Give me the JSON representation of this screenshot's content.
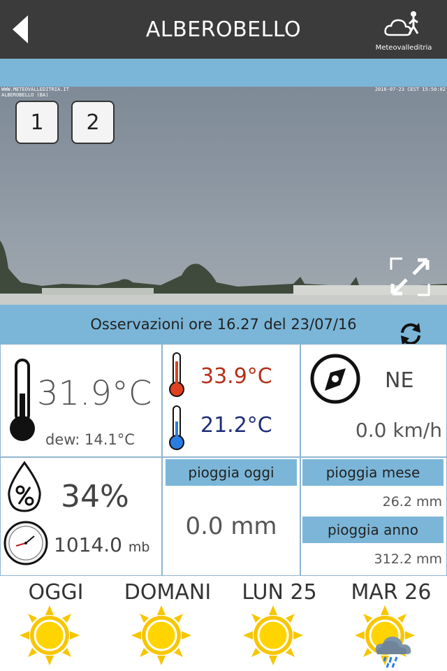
{
  "header": {
    "title": "ALBEROBELLO",
    "logo_text": "Meteovalleditria"
  },
  "webcam": {
    "overlay_left": "WWW.METEOVALLEDITRIA.IT\nALBEROBELLO (BA)",
    "overlay_right": "2016-07-23 CEST 15:50:02",
    "buttons": [
      "1",
      "2"
    ]
  },
  "observation": {
    "text": "Osservazioni ore 16.27 del 23/07/16"
  },
  "current": {
    "temperature": "31.9°C",
    "dew_point": "dew: 14.1°C",
    "max_temp": "33.9°C",
    "min_temp": "21.2°C",
    "wind_direction": "NE",
    "wind_speed": "0.0 km/h",
    "humidity": "34%",
    "pressure_value": "1014.0",
    "pressure_unit": "mb"
  },
  "rain": {
    "today_label": "pioggia oggi",
    "today_value": "0.0 mm",
    "month_label": "pioggia mese",
    "month_value": "26.2 mm",
    "year_label": "pioggia anno",
    "year_value": "312.2 mm"
  },
  "forecast": [
    {
      "day": "OGGI",
      "icon": "sun-icon"
    },
    {
      "day": "DOMANI",
      "icon": "sun-icon"
    },
    {
      "day": "LUN 25",
      "icon": "sun-icon"
    },
    {
      "day": "MAR 26",
      "icon": "sun-rain-cloud-icon"
    }
  ],
  "colors": {
    "header_bg": "#3b3b3b",
    "accent_blue": "#7bb6d8",
    "max_temp": "#b5301a",
    "min_temp": "#1f2e7a",
    "sun": "#f7c600"
  }
}
